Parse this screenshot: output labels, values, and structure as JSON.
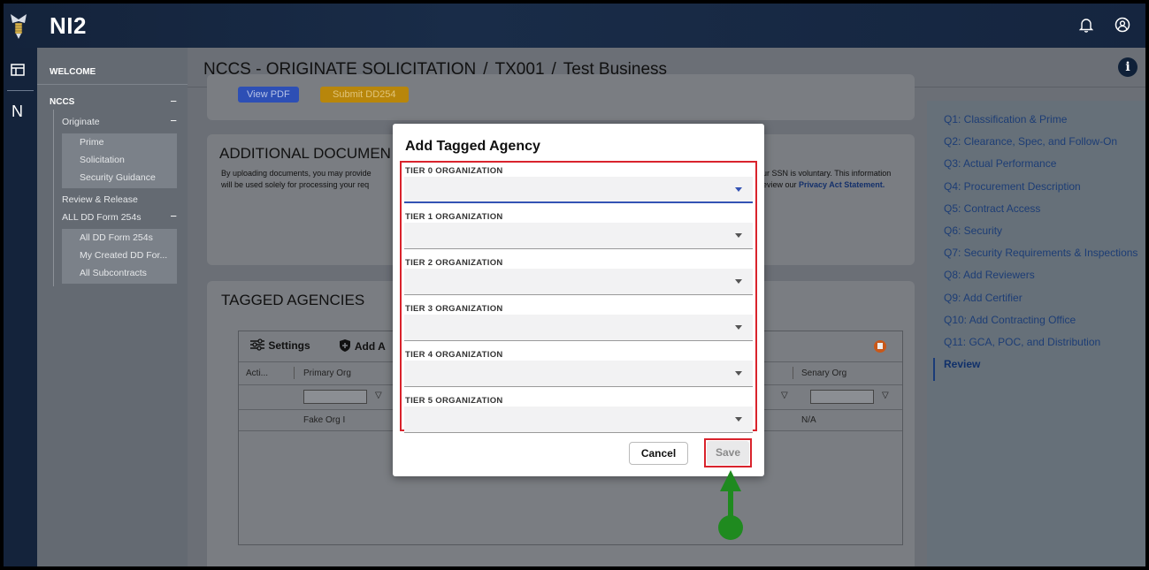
{
  "app": {
    "title": "NI2"
  },
  "header": {
    "bell": "🔔",
    "account": "◎"
  },
  "sidebar": {
    "welcome": "WELCOME",
    "nccs": "NCCS",
    "originate": "Originate",
    "originate_items": [
      "Prime",
      "Solicitation",
      "Security Guidance"
    ],
    "review_release": "Review & Release",
    "all_dd_254s": "ALL DD Form 254s",
    "dd_items": [
      "All DD Form 254s",
      "My Created DD For...",
      "All Subcontracts"
    ],
    "collapse": "−"
  },
  "page": {
    "title_main": "NCCS - ORIGINATE SOLICITATION",
    "crumb_id": "TX001",
    "crumb_name": "Test Business",
    "slash": "/",
    "info": "i"
  },
  "top_card": {
    "view_pdf": "View PDF",
    "submit": "Submit DD254"
  },
  "additional_docs": {
    "title": "ADDITIONAL DOCUMEN",
    "text_left_1": "By uploading documents, you may provide",
    "text_left_2": "will be used solely for processing your req",
    "text_right_1": "ur SSN is voluntary. This information",
    "text_right_2_prefix": "eview our ",
    "text_right_2_link": "Privacy Act Statement."
  },
  "tagged_agencies": {
    "title": "TAGGED AGENCIES",
    "settings": "Settings",
    "add": "Add A",
    "columns": {
      "actions": "Acti...",
      "primary": "Primary Org",
      "senary": "Senary Org"
    },
    "row": {
      "primary": "Fake Org I",
      "senary": "N/A"
    },
    "filter_icon": "▽"
  },
  "toc": {
    "items": [
      "Q1: Classification & Prime",
      "Q2: Clearance, Spec, and Follow-On",
      "Q3: Actual Performance",
      "Q4: Procurement Description",
      "Q5: Contract Access",
      "Q6: Security",
      "Q7: Security Requirements & Inspections",
      "Q8: Add Reviewers",
      "Q9: Add Certifier",
      "Q10: Add Contracting Office",
      "Q11: GCA, POC, and Distribution",
      "Review"
    ],
    "active": "Review"
  },
  "modal": {
    "title": "Add Tagged Agency",
    "fields": [
      {
        "label": "TIER 0 ORGANIZATION",
        "value": ""
      },
      {
        "label": "TIER 1 ORGANIZATION",
        "value": ""
      },
      {
        "label": "TIER 2 ORGANIZATION",
        "value": ""
      },
      {
        "label": "TIER 3 ORGANIZATION",
        "value": ""
      },
      {
        "label": "TIER 4 ORGANIZATION",
        "value": ""
      },
      {
        "label": "TIER 5 ORGANIZATION",
        "value": ""
      }
    ],
    "cancel": "Cancel",
    "save": "Save"
  },
  "colors": {
    "topbar": "#15253f",
    "highlight": "#d9232c",
    "pointer": "#1f8a1f",
    "primary_blue": "#3453b4"
  }
}
